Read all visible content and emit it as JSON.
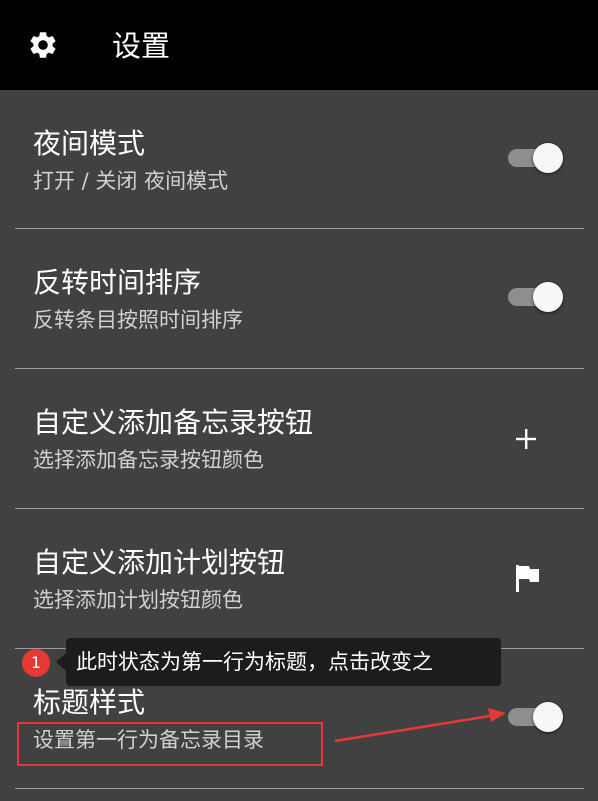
{
  "header": {
    "title": "设置",
    "icon": "gear-icon"
  },
  "settings": [
    {
      "title": "夜间模式",
      "subtitle": "打开 / 关闭 夜间模式",
      "control": "switch",
      "checked": true
    },
    {
      "title": "反转时间排序",
      "subtitle": "反转条目按照时间排序",
      "control": "switch",
      "checked": true
    },
    {
      "title": "自定义添加备忘录按钮",
      "subtitle": "选择添加备忘录按钮颜色",
      "control": "plus-icon"
    },
    {
      "title": "自定义添加计划按钮",
      "subtitle": "选择添加计划按钮颜色",
      "control": "flag-icon"
    },
    {
      "title": "标题样式",
      "subtitle": "设置第一行为备忘录目录",
      "control": "switch",
      "checked": true
    }
  ],
  "annotation": {
    "step_number": "1",
    "tooltip_text": "此时状态为第一行为标题，点击改变之",
    "highlight_color": "#e53935"
  },
  "colors": {
    "background": "#414141",
    "appbar": "#000000",
    "switch_track": "#8e8e8e",
    "switch_thumb": "#f7f7f7"
  }
}
